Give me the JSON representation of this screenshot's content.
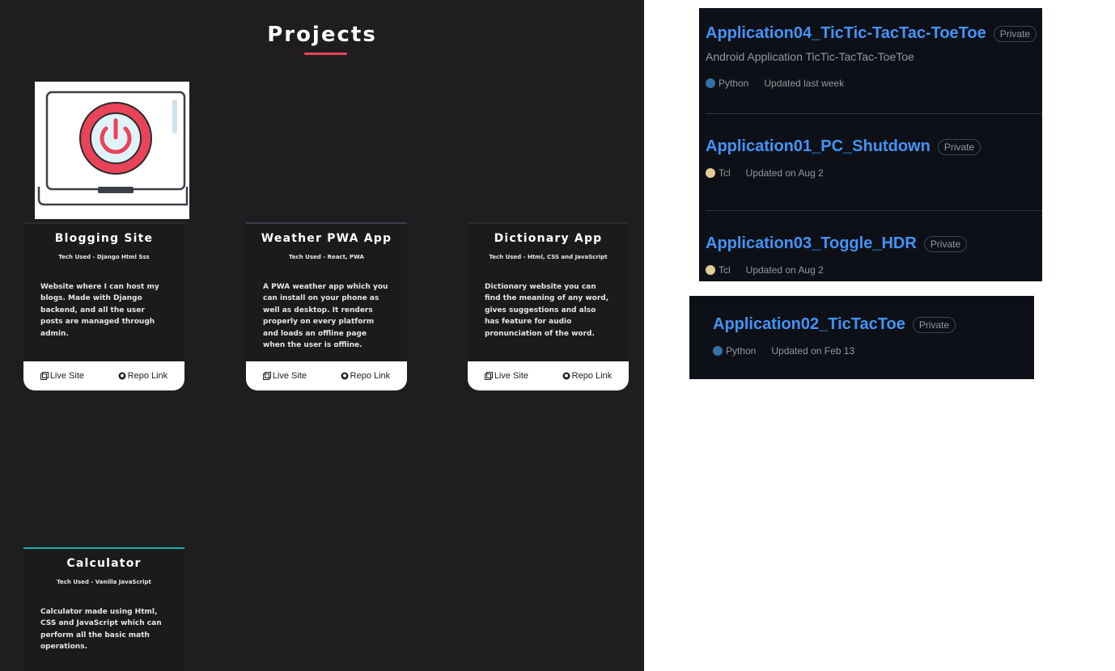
{
  "projects": {
    "title": "Projects",
    "cards": [
      {
        "name": "Blogging Site",
        "tech": "Tech Used - Django Html Sss",
        "desc": "Website where I can host my blogs. Made with Django backend, and all the user posts are managed through admin.",
        "live_label": "Live Site",
        "repo_label": "Repo Link"
      },
      {
        "name": "Weather PWA App",
        "tech": "Tech Used - React, PWA",
        "desc": "A PWA weather app which you can install on your phone as well as desktop. It renders properly on every platform and loads an offline page when the user is offline.",
        "live_label": "Live Site",
        "repo_label": "Repo Link"
      },
      {
        "name": "Dictionary App",
        "tech": "Tech Used - Html, CSS and JavaScript",
        "desc": "Dictionary website you can find the meaning of any word, gives suggestions and also has feature for audio pronunciation of the word.",
        "live_label": "Live Site",
        "repo_label": "Repo Link"
      },
      {
        "name": "Calculator",
        "tech": "Tech Used - Vanilla JavaScript",
        "desc": "Calculator made using Html, CSS and JavaScript which can perform all the basic math operations."
      }
    ]
  },
  "github": {
    "repos": [
      {
        "name": "Application04_TicTic-TacTac-ToeToe",
        "badge": "Private",
        "desc": "Android Application TicTic-TacTac-ToeToe",
        "lang": "Python",
        "lang_color": "#3572A5",
        "updated": "Updated last week"
      },
      {
        "name": "Application01_PC_Shutdown",
        "badge": "Private",
        "lang": "Tcl",
        "lang_color": "#e4cc98",
        "updated": "Updated on Aug 2"
      },
      {
        "name": "Application03_Toggle_HDR",
        "badge": "Private",
        "lang": "Tcl",
        "lang_color": "#e4cc98",
        "updated": "Updated on Aug 2"
      }
    ],
    "card": {
      "name": "Application02_TicTacToe",
      "badge": "Private",
      "lang": "Python",
      "lang_color": "#3572A5",
      "updated": "Updated on Feb 13"
    }
  }
}
